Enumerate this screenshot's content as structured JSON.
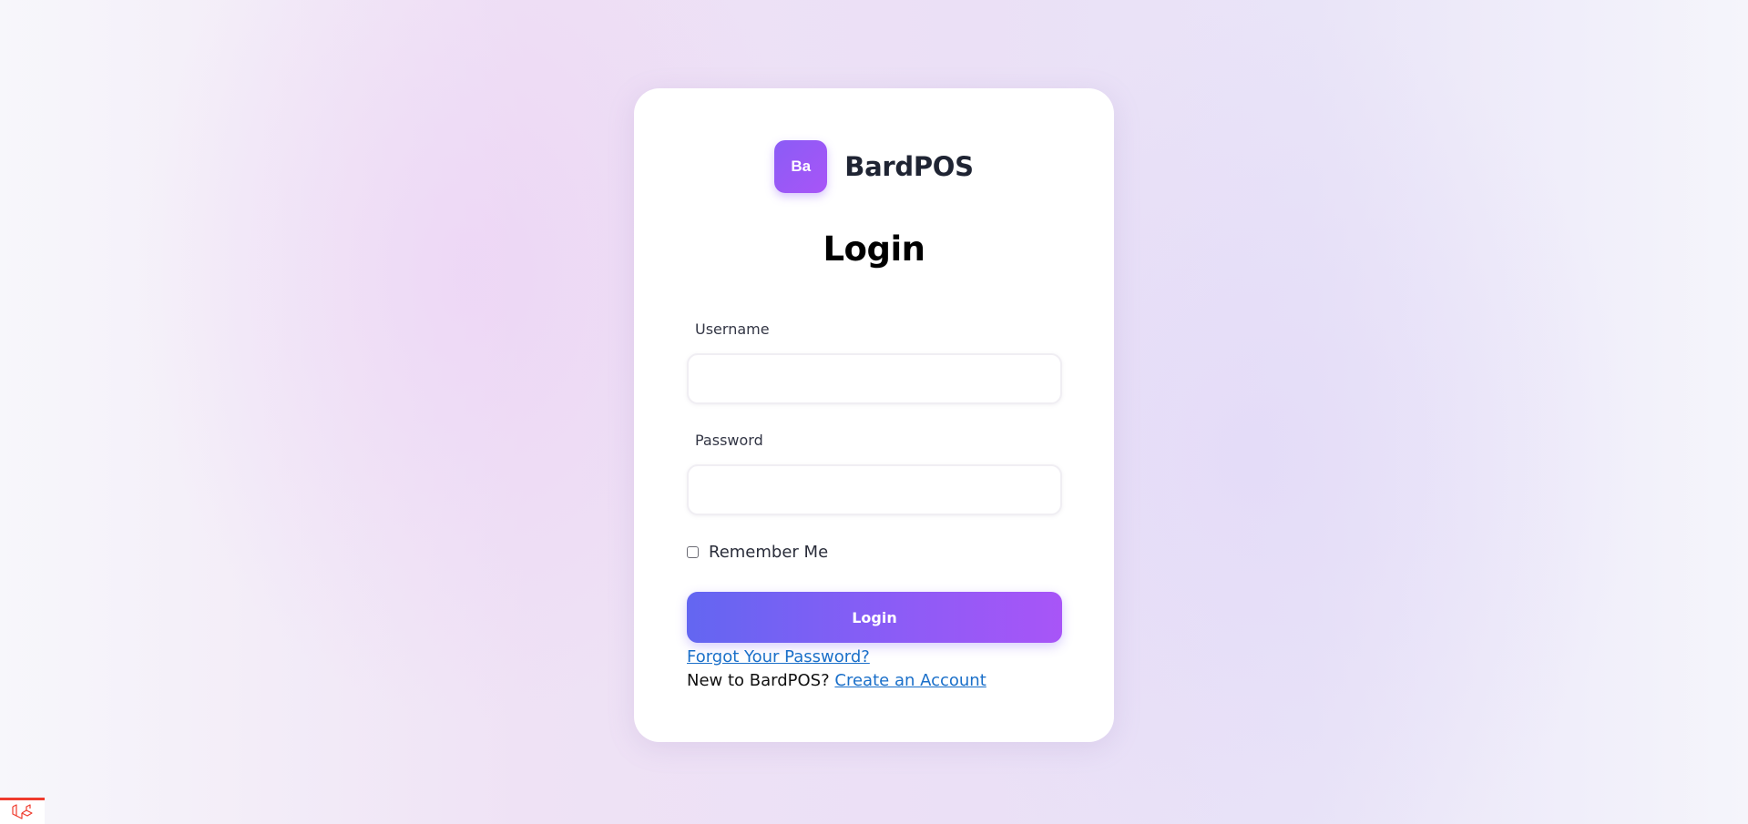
{
  "brand": {
    "logo_text": "Ba",
    "name": "BardPOS",
    "logo_color": "#8b5cf6"
  },
  "form": {
    "title": "Login",
    "username_label": "Username",
    "username_value": "",
    "password_label": "Password",
    "password_value": "",
    "remember_label": "Remember Me",
    "remember_checked": false,
    "submit_label": "Login"
  },
  "links": {
    "forgot_password": "Forgot Your Password?",
    "signup_prompt": "New to BardPOS?",
    "create_account": "Create an Account"
  },
  "debug_badge": {
    "icon": "laravel-icon",
    "accent_color": "#ef3b2d"
  },
  "colors": {
    "accent_start": "#6366f1",
    "accent_end": "#a855f7",
    "link": "#1a6fc9"
  }
}
